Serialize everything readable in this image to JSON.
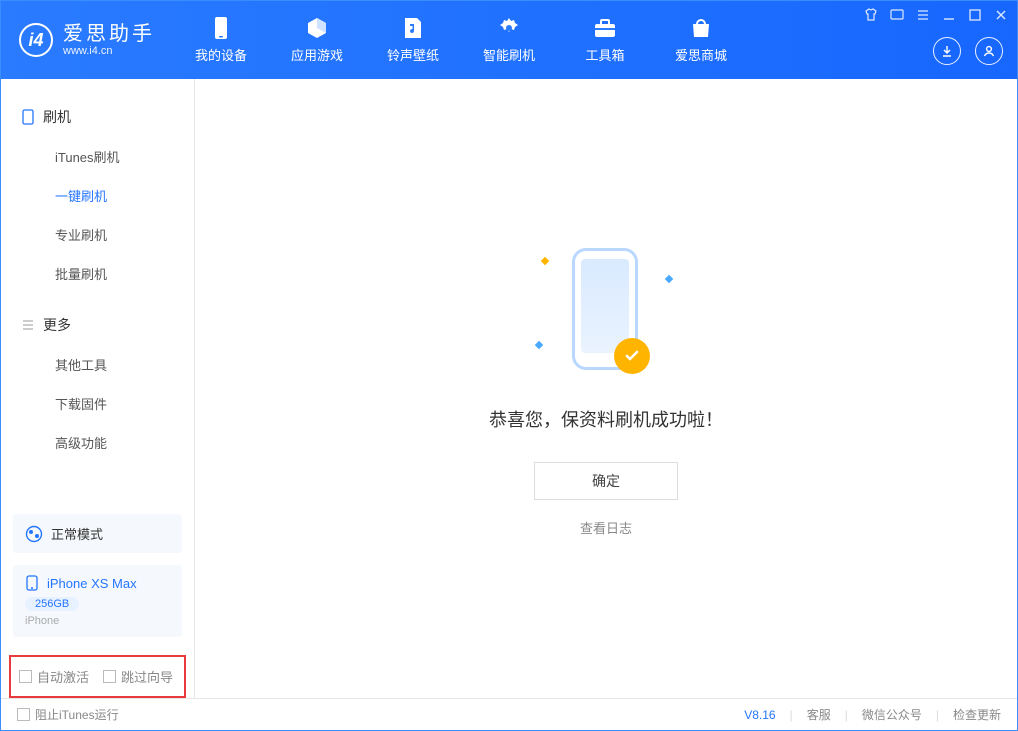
{
  "app": {
    "name": "爱思助手",
    "url": "www.i4.cn"
  },
  "header": {
    "navs": [
      {
        "label": "我的设备"
      },
      {
        "label": "应用游戏"
      },
      {
        "label": "铃声壁纸"
      },
      {
        "label": "智能刷机"
      },
      {
        "label": "工具箱"
      },
      {
        "label": "爱思商城"
      }
    ]
  },
  "sidebar": {
    "section1": {
      "title": "刷机"
    },
    "items1": [
      {
        "label": "iTunes刷机",
        "active": false
      },
      {
        "label": "一键刷机",
        "active": true
      },
      {
        "label": "专业刷机",
        "active": false
      },
      {
        "label": "批量刷机",
        "active": false
      }
    ],
    "section2": {
      "title": "更多"
    },
    "items2": [
      {
        "label": "其他工具"
      },
      {
        "label": "下载固件"
      },
      {
        "label": "高级功能"
      }
    ],
    "mode_card": {
      "label": "正常模式"
    },
    "device": {
      "name": "iPhone XS Max",
      "capacity": "256GB",
      "type": "iPhone"
    },
    "checks": {
      "auto_activate": "自动激活",
      "skip_guide": "跳过向导"
    }
  },
  "main": {
    "message": "恭喜您，保资料刷机成功啦！",
    "ok_button": "确定",
    "log_link": "查看日志"
  },
  "footer": {
    "block_itunes": "阻止iTunes运行",
    "version": "V8.16",
    "links": {
      "service": "客服",
      "wechat": "微信公众号",
      "update": "检查更新"
    }
  }
}
